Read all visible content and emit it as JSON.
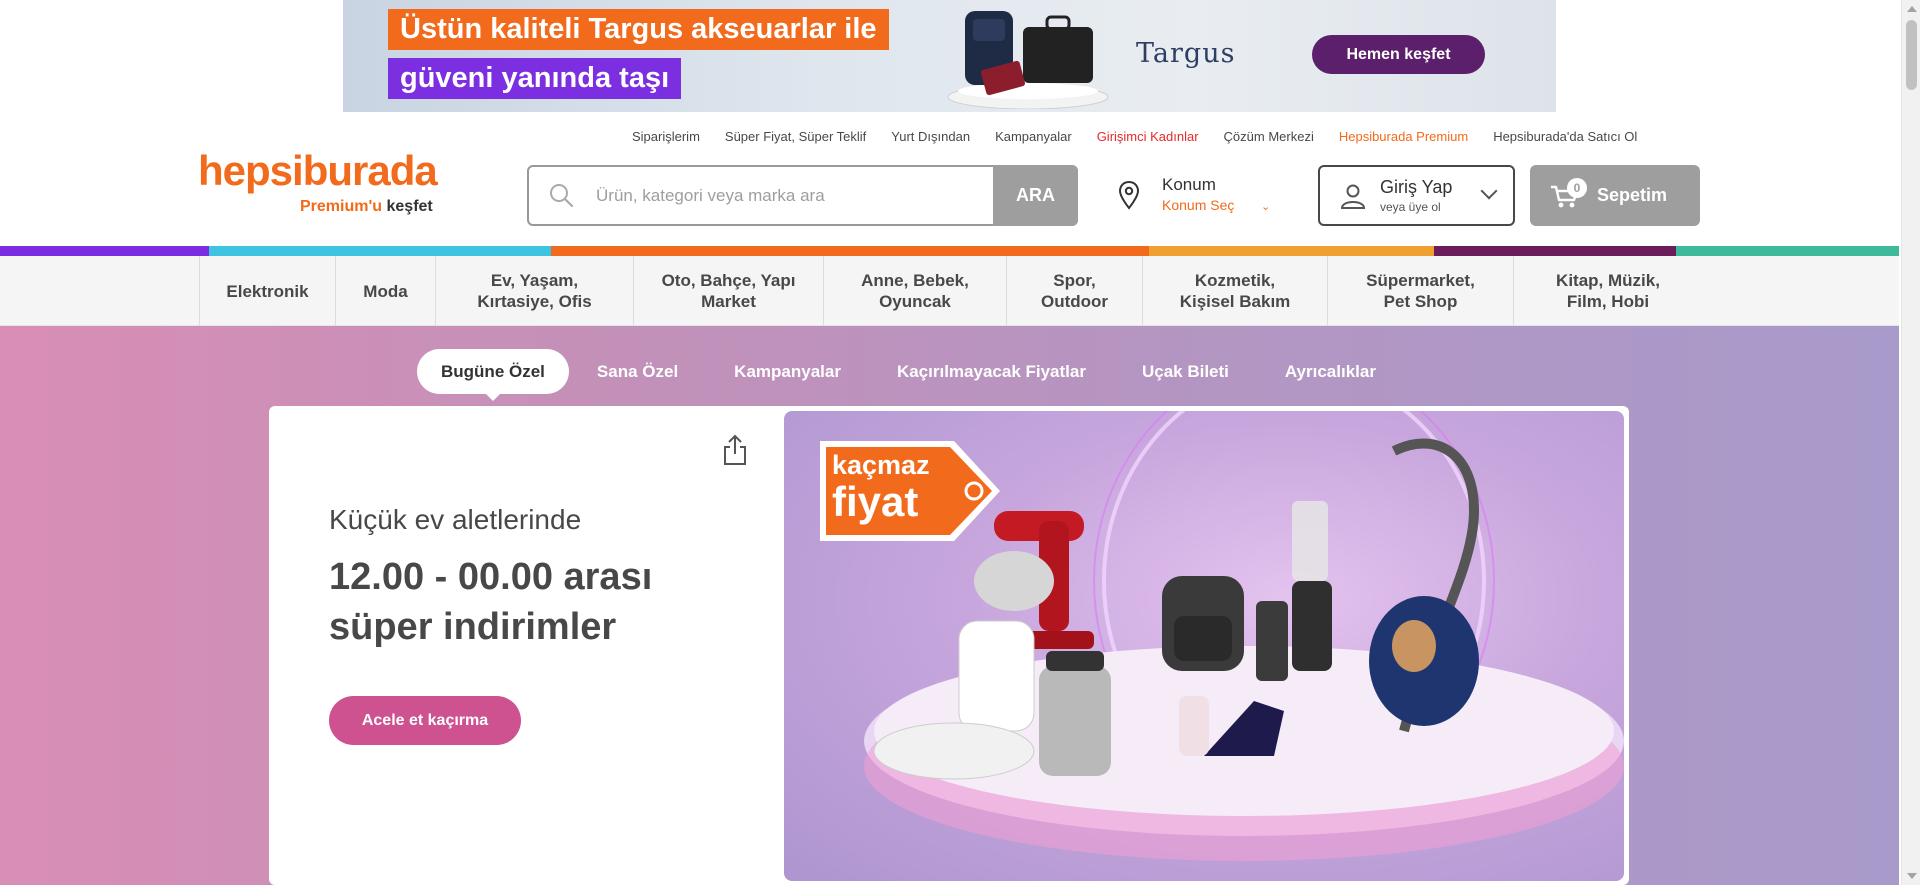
{
  "ad": {
    "line1": "Üstün kaliteli Targus akseuarlar ile",
    "line2": "güveni yanında taşı",
    "brand": "Targus",
    "cta": "Hemen keşfet"
  },
  "top_links": [
    {
      "label": "Siparişlerim",
      "style": "normal"
    },
    {
      "label": "Süper Fiyat, Süper Teklif",
      "style": "normal"
    },
    {
      "label": "Yurt Dışından",
      "style": "normal"
    },
    {
      "label": "Kampanyalar",
      "style": "normal"
    },
    {
      "label": "Girişimci Kadınlar",
      "style": "red"
    },
    {
      "label": "Çözüm Merkezi",
      "style": "normal"
    },
    {
      "label": "Hepsiburada Premium",
      "style": "orange"
    },
    {
      "label": "Hepsiburada'da Satıcı Ol",
      "style": "normal"
    }
  ],
  "logo": {
    "main": "hepsiburada",
    "sub_highlight": "Premium'u",
    "sub_rest": "keşfet"
  },
  "search": {
    "placeholder": "Ürün, kategori veya marka ara",
    "button": "ARA"
  },
  "location": {
    "title": "Konum",
    "sub": "Konum Seç"
  },
  "login": {
    "title": "Giriş Yap",
    "sub": "veya üye ol"
  },
  "cart": {
    "count": "0",
    "label": "Sepetim"
  },
  "strip_colors": [
    "#7b2ce0",
    "#3ec3e0",
    "#f26a1b",
    "#f0a030",
    "#6b1c5a",
    "#3dba9a"
  ],
  "categories": [
    {
      "label": "Elektronik"
    },
    {
      "label": "Moda"
    },
    {
      "label": "Ev, Yaşam,\nKırtasiye, Ofis"
    },
    {
      "label": "Oto, Bahçe, Yapı\nMarket"
    },
    {
      "label": "Anne, Bebek,\nOyuncak"
    },
    {
      "label": "Spor,\nOutdoor"
    },
    {
      "label": "Kozmetik,\nKişisel Bakım"
    },
    {
      "label": "Süpermarket,\nPet Shop"
    },
    {
      "label": "Kitap, Müzik,\nFilm, Hobi"
    }
  ],
  "hero_tabs": [
    {
      "label": "Bugüne Özel",
      "active": true
    },
    {
      "label": "Sana Özel",
      "active": false
    },
    {
      "label": "Kampanyalar",
      "active": false
    },
    {
      "label": "Kaçırılmayacak Fiyatlar",
      "active": false
    },
    {
      "label": "Uçak Bileti",
      "active": false
    },
    {
      "label": "Ayrıcalıklar",
      "active": false
    }
  ],
  "promo": {
    "subtitle": "Küçük ev aletlerinde",
    "title": "12.00 - 00.00 arası süper indirimler",
    "button": "Acele et kaçırma",
    "tag_line1": "kaçmaz",
    "tag_line2": "fiyat"
  },
  "colors": {
    "brand_orange": "#f26a1b",
    "promo_pink": "#cd528f",
    "gray_button": "#9e9e9e"
  }
}
